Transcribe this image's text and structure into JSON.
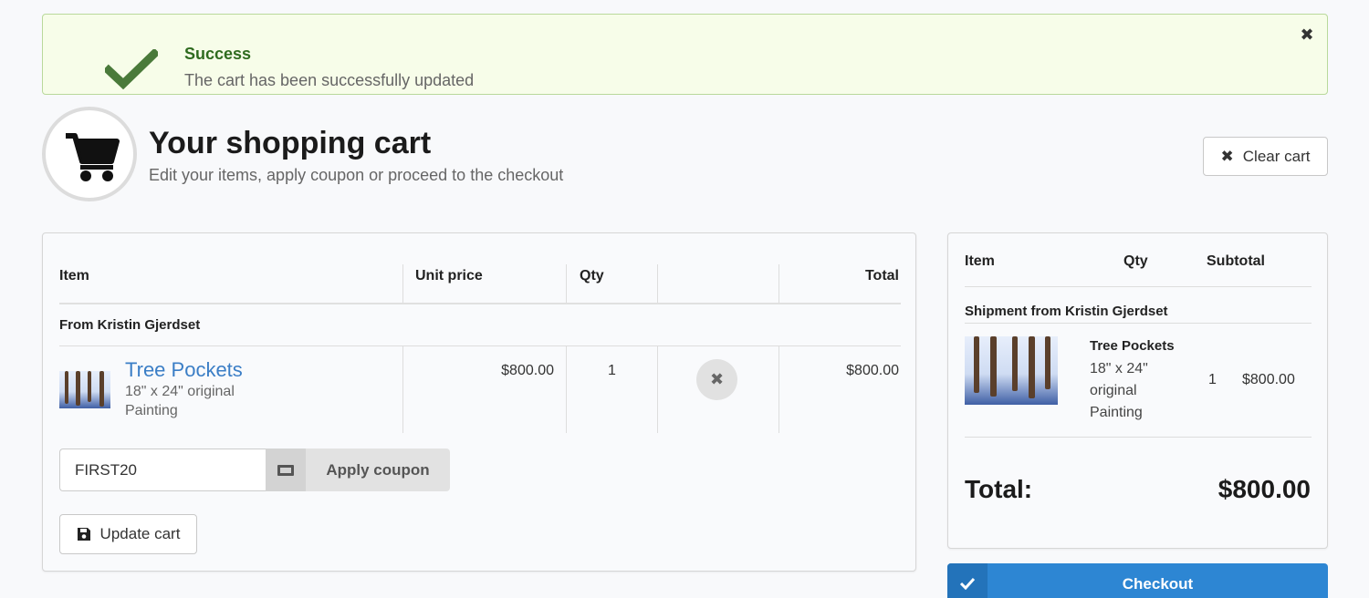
{
  "alert": {
    "title": "Success",
    "message": "The cart has been successfully updated",
    "close_glyph": "✖",
    "color": "#2f6b1f"
  },
  "header": {
    "title": "Your shopping cart",
    "subtitle": "Edit your items, apply coupon or proceed to the checkout",
    "icon": "shopping-cart-icon"
  },
  "clear_cart": {
    "icon_glyph": "✖",
    "label": "Clear cart"
  },
  "cart_table": {
    "columns": [
      "Item",
      "Unit price",
      "Qty",
      "",
      "Total"
    ],
    "seller": "From Kristin Gjerdset",
    "items": [
      {
        "name": "Tree Pockets",
        "desc1": "18\" x 24\" original",
        "desc2": "Painting",
        "unit_price": "$800.00",
        "qty": "1",
        "remove_glyph": "✖",
        "total": "$800.00"
      }
    ]
  },
  "coupon": {
    "value": "FIRST20",
    "icon": "ticket-icon",
    "button_label": "Apply coupon"
  },
  "update_cart": {
    "icon": "floppy-disk-icon",
    "label": "Update cart"
  },
  "summary": {
    "columns": [
      "Item",
      "Qty",
      "Subtotal"
    ],
    "seller": "Shipment from Kristin Gjerdset",
    "item": {
      "name": "Tree Pockets",
      "desc": "18\" x 24\" original Painting",
      "qty": "1",
      "subtotal": "$800.00"
    },
    "total_label": "Total:",
    "total_value": "$800.00"
  },
  "checkout": {
    "label": "Checkout",
    "color": "#2d86d3"
  }
}
